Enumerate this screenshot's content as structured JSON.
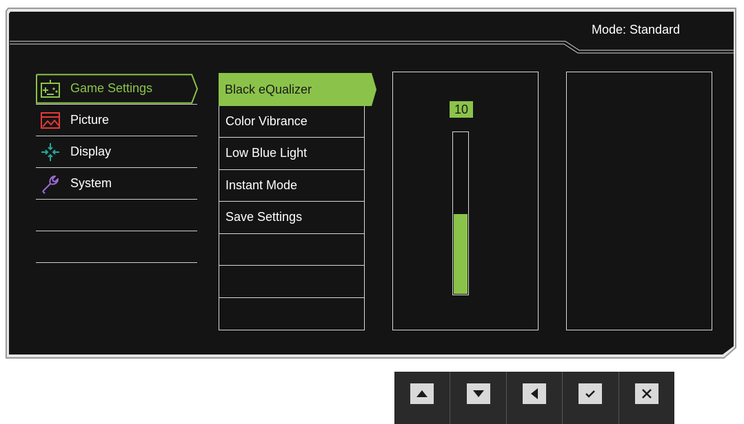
{
  "header": {
    "mode_label": "Mode: Standard"
  },
  "main_menu": {
    "items": [
      {
        "label": "Game Settings",
        "icon": "gamepad-icon",
        "active": true
      },
      {
        "label": "Picture",
        "icon": "picture-icon"
      },
      {
        "label": "Display",
        "icon": "display-arrows-icon"
      },
      {
        "label": "System",
        "icon": "wrench-icon"
      },
      {
        "label": ""
      },
      {
        "label": ""
      }
    ]
  },
  "sub_menu": {
    "items": [
      {
        "label": "Black eQualizer",
        "active": true
      },
      {
        "label": "Color Vibrance"
      },
      {
        "label": "Low Blue Light"
      },
      {
        "label": "Instant Mode"
      },
      {
        "label": "Save Settings"
      },
      {
        "label": ""
      },
      {
        "label": ""
      },
      {
        "label": ""
      }
    ]
  },
  "slider": {
    "value": "10",
    "level_fraction": 0.5
  },
  "control_keys": [
    {
      "icon": "up-arrow-icon"
    },
    {
      "icon": "down-arrow-icon"
    },
    {
      "icon": "left-arrow-icon"
    },
    {
      "icon": "check-icon"
    },
    {
      "icon": "close-icon"
    }
  ],
  "colors": {
    "accent": "#8bc34a",
    "background": "#141414",
    "border": "#d9d9d9"
  }
}
